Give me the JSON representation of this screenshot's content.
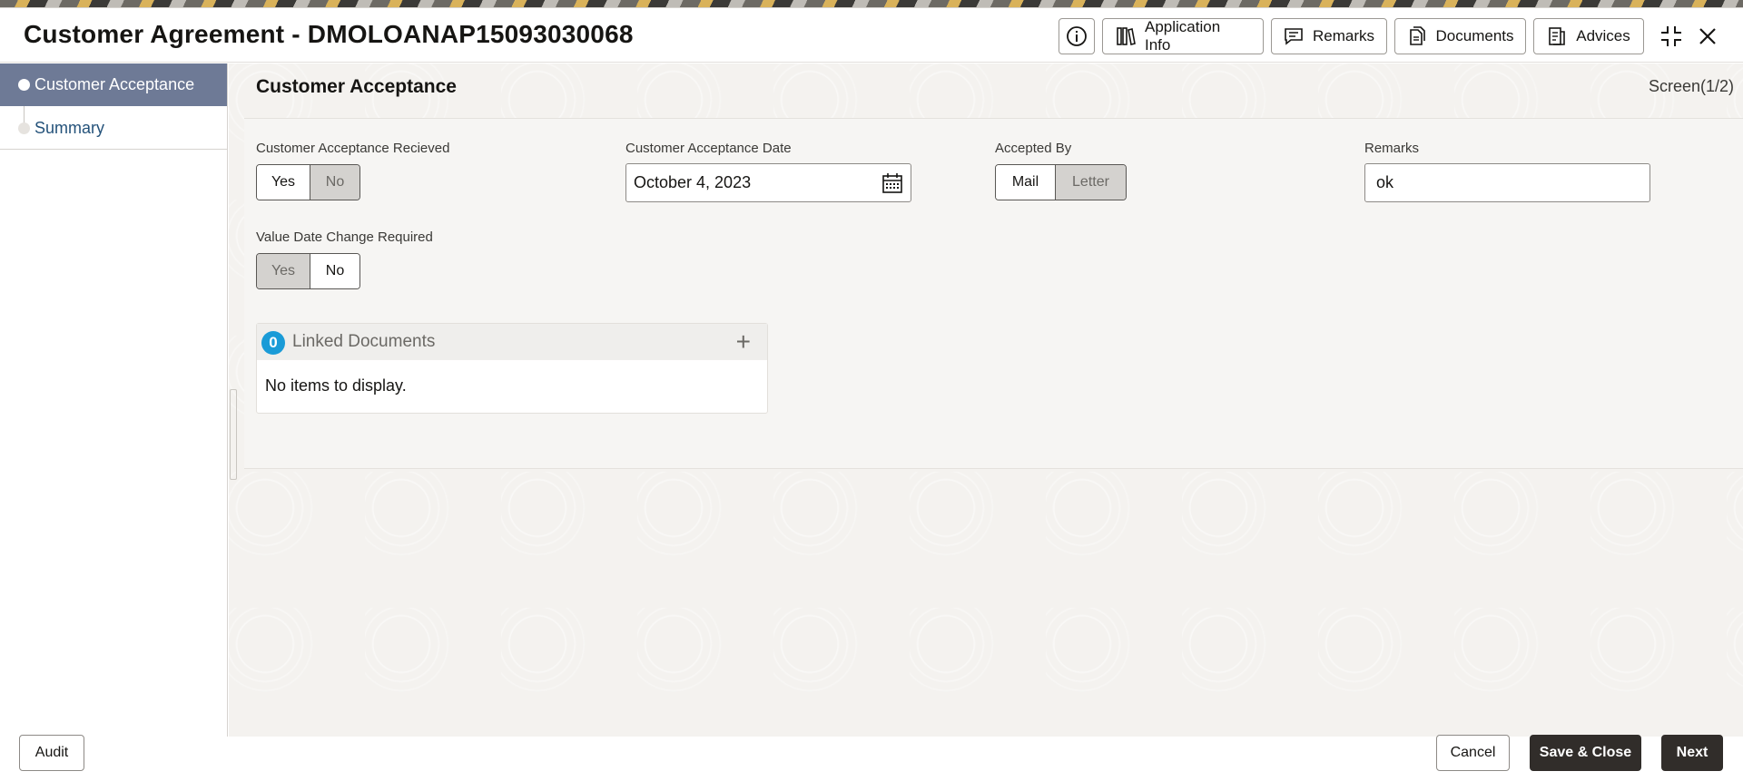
{
  "window": {
    "title": "Customer Agreement - DMOLOANAP15093030068"
  },
  "header": {
    "info_label": "info",
    "buttons": [
      {
        "label": "Application Info",
        "icon": "books-icon"
      },
      {
        "label": "Remarks",
        "icon": "comment-icon"
      },
      {
        "label": "Documents",
        "icon": "documents-icon"
      },
      {
        "label": "Advices",
        "icon": "advices-icon"
      }
    ],
    "icons": [
      "info-icon",
      "collapse-icon",
      "close-icon"
    ]
  },
  "sidebar": {
    "items": [
      {
        "label": "Customer Acceptance",
        "active": true
      },
      {
        "label": "Summary",
        "active": false
      }
    ]
  },
  "main": {
    "section_title": "Customer Acceptance",
    "screen_indicator": "Screen(1/2)",
    "fields": {
      "acceptance_received": {
        "label": "Customer Acceptance Recieved",
        "options": [
          "Yes",
          "No"
        ],
        "selected": "Yes"
      },
      "acceptance_date": {
        "label": "Customer Acceptance Date",
        "value": "October 4, 2023"
      },
      "accepted_by": {
        "label": "Accepted By",
        "options": [
          "Mail",
          "Letter"
        ],
        "selected": "Mail"
      },
      "remarks": {
        "label": "Remarks",
        "value": "ok"
      },
      "value_date_change": {
        "label": "Value Date Change Required",
        "options": [
          "Yes",
          "No"
        ],
        "selected": "No"
      }
    },
    "linked_documents": {
      "count": "0",
      "title": "Linked Documents",
      "empty_text": "No items to display."
    }
  },
  "footer": {
    "audit_label": "Audit",
    "cancel_label": "Cancel",
    "save_close_label": "Save & Close",
    "next_label": "Next"
  },
  "colors": {
    "sidebar_active": "#6e7a96",
    "link": "#24527a",
    "badge": "#1a9bd7",
    "primary_button": "#312d2a"
  }
}
